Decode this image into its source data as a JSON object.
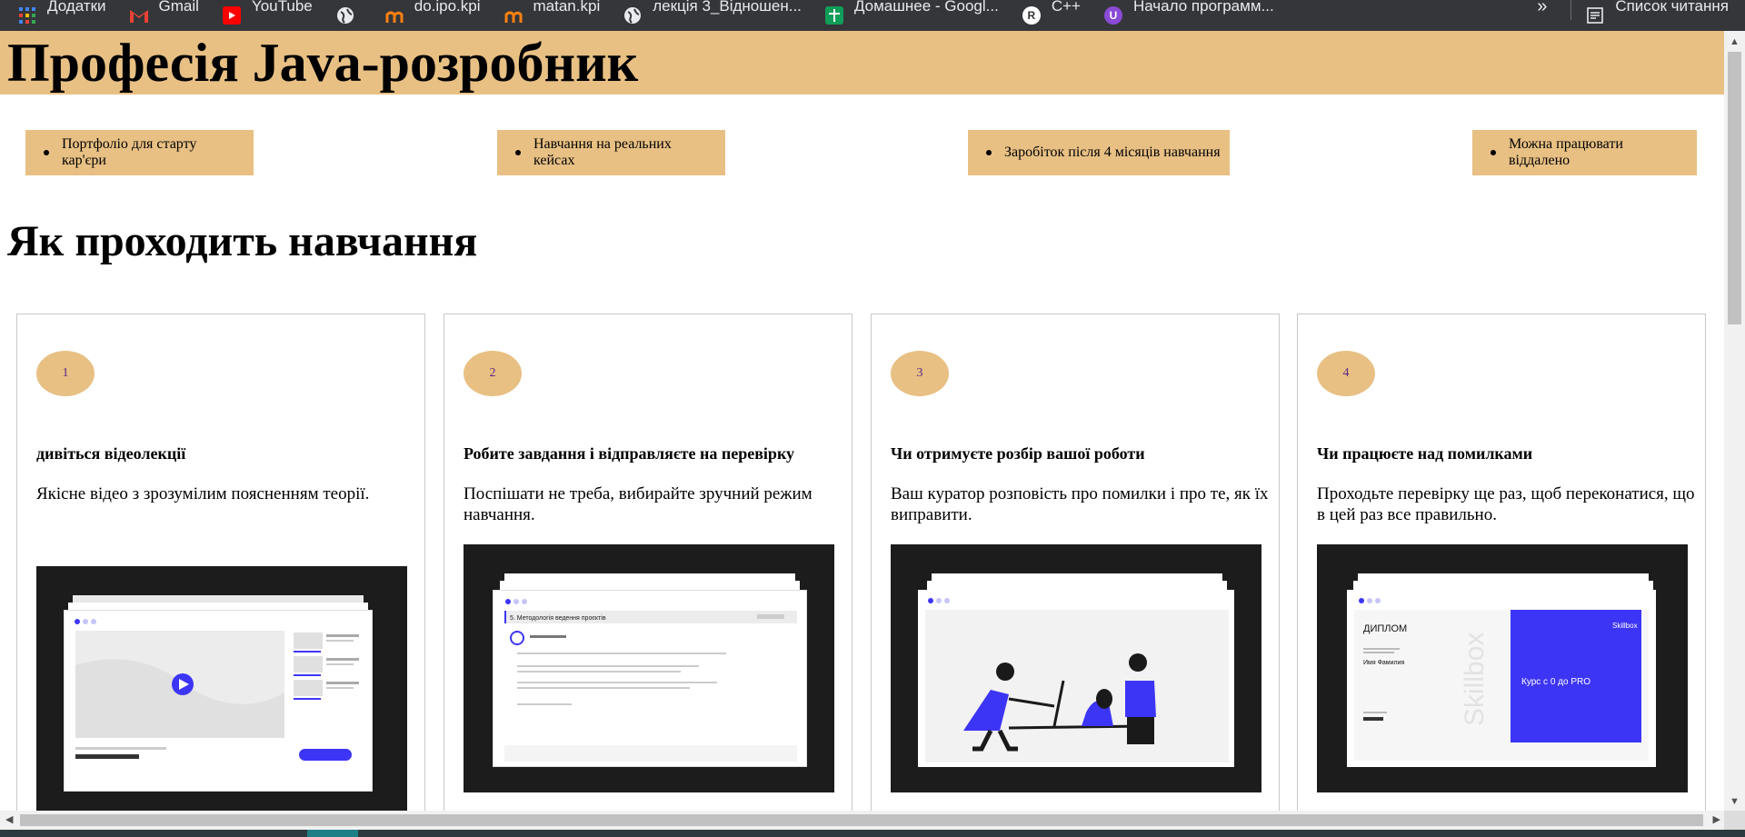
{
  "bookmarks": [
    {
      "label": "Додатки",
      "icon": "apps-grid-icon",
      "color": "#4285f4"
    },
    {
      "label": "Gmail",
      "icon": "gmail-icon",
      "color": "#ea4335"
    },
    {
      "label": "YouTube",
      "icon": "youtube-icon",
      "color": "#ff0000"
    },
    {
      "label": "do.ipo.kpi",
      "icon": "moodle-icon",
      "color": "#f98012"
    },
    {
      "label": "matan.kpi",
      "icon": "moodle-icon",
      "color": "#f98012"
    },
    {
      "label": "лекція 3_Відношен...",
      "icon": "globe-icon",
      "color": "#9aa0a6"
    },
    {
      "label": "Домашнее - Googl...",
      "icon": "google-sheets-icon",
      "color": "#0f9d58"
    },
    {
      "label": "C++",
      "icon": "site-icon",
      "color": "#ffffff"
    },
    {
      "label": "Начало программ...",
      "icon": "site-icon",
      "color": "#8a4bd6"
    }
  ],
  "bookmarks_right": {
    "more": "»",
    "reading_list": "Список читання"
  },
  "hero": {
    "title": "Професія Java-розробник"
  },
  "features": [
    "Портфоліо для старту кар'єри",
    "Навчання на реальних кейсах",
    "Заробіток після 4 місяців навчання",
    "Можна працювати віддалено"
  ],
  "section_title": "Як проходить навчання",
  "cards": [
    {
      "step": "1",
      "title": "дивіться відеолекції",
      "text": "Якісне відео з зрозумілим поясненням теорії.",
      "image": "video-lecture-screenshot"
    },
    {
      "step": "2",
      "title": "Робите завдання і відправляєте на перевірку",
      "text": "Поспішати не треба, вибирайте зручний режим навчання.",
      "image": "task-submission-screenshot",
      "image_caption": "5. Методологія ведення проєктів"
    },
    {
      "step": "3",
      "title": "Чи отримуєте розбір вашої роботи",
      "text": "Ваш куратор розповість про помилки і про те, як їх виправити.",
      "image": "code-review-illustration"
    },
    {
      "step": "4",
      "title": "Чи працюєте над помилками",
      "text": "Проходьте перевірку ще раз, щоб переконатися, що в цей раз все правильно.",
      "image": "diploma-screenshot",
      "diploma": {
        "heading": "ДИПЛОМ",
        "name": "Имя Фамилия",
        "brand": "Skillbox",
        "course": "Курс с 0 до PRO"
      }
    }
  ],
  "colors": {
    "accent": "#e8c084",
    "step_text": "#5b2a86",
    "brand_blue": "#3d35f5"
  }
}
